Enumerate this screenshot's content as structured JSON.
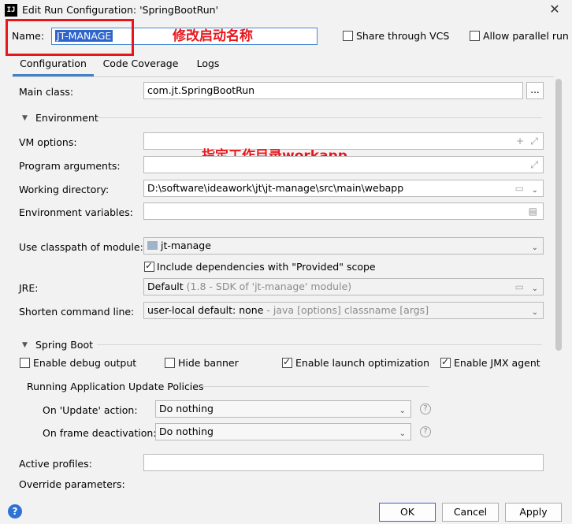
{
  "window": {
    "app_icon": "IJ",
    "title": "Edit Run Configuration: 'SpringBootRun'"
  },
  "name_row": {
    "label": "Name:",
    "value": "JT-MANAGE",
    "share_vcs": "Share through VCS",
    "allow_parallel": "Allow parallel run"
  },
  "annotations": {
    "rename": "修改启动名称",
    "workdir": "指定工作目录workapp"
  },
  "tabs": [
    "Configuration",
    "Code Coverage",
    "Logs"
  ],
  "config": {
    "main_class_label": "Main class:",
    "main_class_value": "com.jt.SpringBootRun",
    "browse": "...",
    "environment_title": "Environment",
    "vm_options_label": "VM options:",
    "program_args_label": "Program arguments:",
    "working_dir_label": "Working directory:",
    "working_dir_value": "D:\\software\\ideawork\\jt\\jt-manage\\src\\main\\webapp",
    "env_vars_label": "Environment variables:",
    "classpath_label": "Use classpath of module:",
    "classpath_value": "jt-manage",
    "include_deps": "Include dependencies with \"Provided\" scope",
    "jre_label": "JRE:",
    "jre_value": "Default",
    "jre_hint": "(1.8 - SDK of 'jt-manage' module)",
    "shorten_label": "Shorten command line:",
    "shorten_value": "user-local default: none",
    "shorten_hint": "- java [options] classname [args]"
  },
  "spring_boot": {
    "title": "Spring Boot",
    "debug_output": "Enable debug output",
    "hide_banner": "Hide banner",
    "launch_opt": "Enable launch optimization",
    "jmx_agent": "Enable JMX agent",
    "update_policies_title": "Running Application Update Policies",
    "update_action_label": "On 'Update' action:",
    "update_action_value": "Do nothing",
    "frame_deact_label": "On frame deactivation:",
    "frame_deact_value": "Do nothing",
    "active_profiles_label": "Active profiles:",
    "override_params_label": "Override parameters:"
  },
  "footer": {
    "help": "?",
    "ok": "OK",
    "cancel": "Cancel",
    "apply": "Apply"
  },
  "colors": {
    "accent": "#2f65ca",
    "annotation": "#e8161b",
    "tab_underline": "#4083c9"
  }
}
